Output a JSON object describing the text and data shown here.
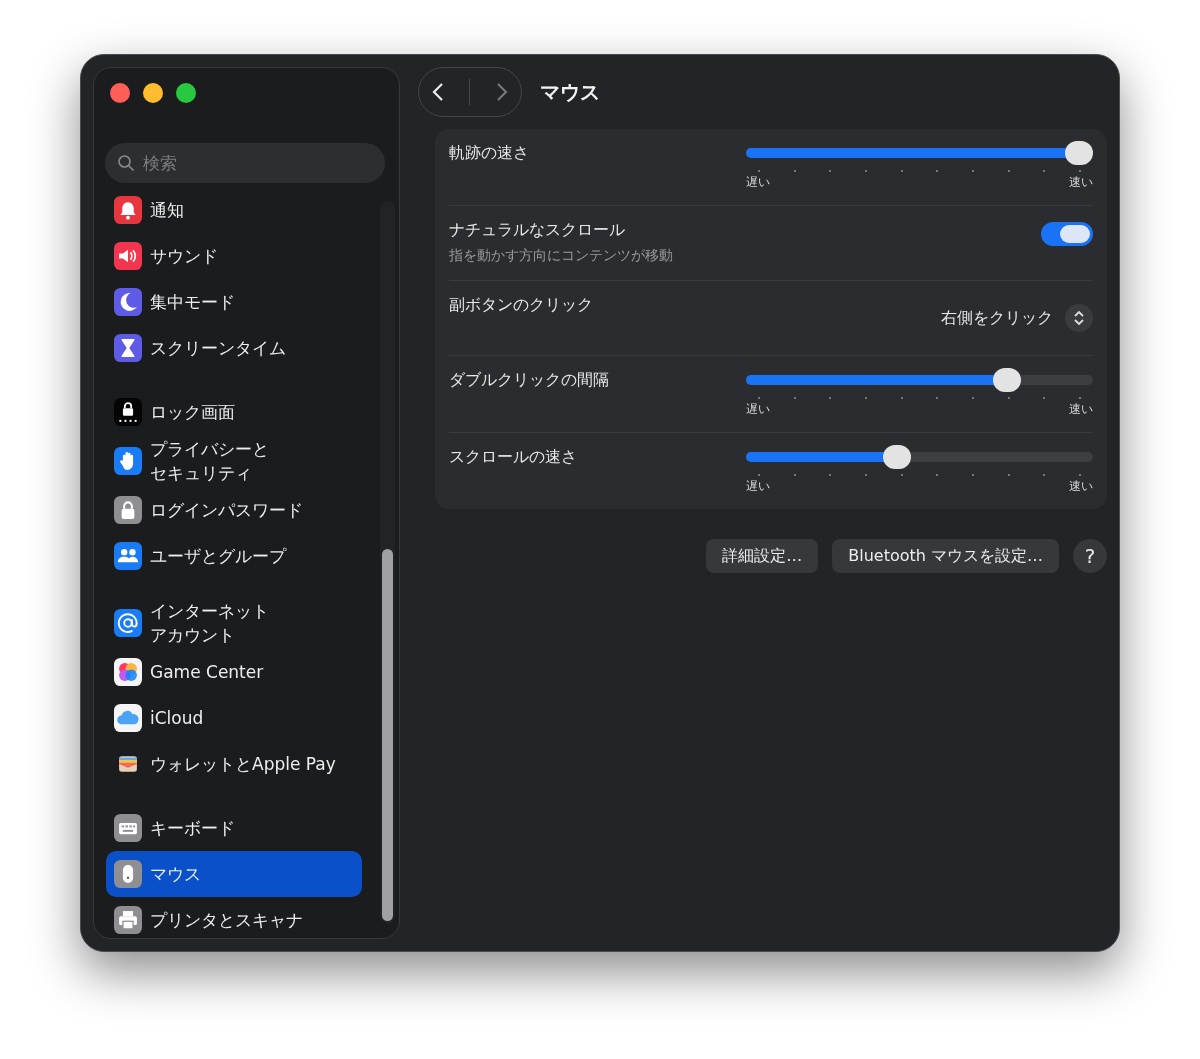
{
  "sidebar": {
    "search": {
      "placeholder": "検索"
    },
    "groups": [
      {
        "items": [
          {
            "label": "通知",
            "selected": false
          },
          {
            "label": "サウンド",
            "selected": false
          },
          {
            "label": "集中モード",
            "selected": false
          },
          {
            "label": "スクリーンタイム",
            "selected": false
          }
        ]
      },
      {
        "items": [
          {
            "label": "ロック画面",
            "selected": false
          },
          {
            "label": "プライバシーとセキュリティ",
            "selected": false,
            "wrapped": true
          },
          {
            "label": "ログインパスワード",
            "selected": false
          },
          {
            "label": "ユーザとグループ",
            "selected": false
          }
        ]
      },
      {
        "items": [
          {
            "label": "インターネットアカウント",
            "selected": false,
            "wrapped": true
          },
          {
            "label": "Game Center",
            "selected": false
          },
          {
            "label": "iCloud",
            "selected": false
          },
          {
            "label": "ウォレットとApple Pay",
            "selected": false
          }
        ]
      },
      {
        "items": [
          {
            "label": "キーボード",
            "selected": false
          },
          {
            "label": "マウス",
            "selected": true
          },
          {
            "label": "プリンタとスキャナ",
            "selected": false
          }
        ]
      }
    ]
  },
  "header": {
    "title": "マウス"
  },
  "settings": [
    {
      "kind": "slider",
      "label": "軌跡の速さ",
      "level": 1.0,
      "min_label": "遅い",
      "max_label": "速い"
    },
    {
      "kind": "toggle",
      "label": "ナチュラルなスクロール",
      "description": "指を動かす方向にコンテンツが移動",
      "on": true
    },
    {
      "kind": "popup",
      "label": "副ボタンのクリック",
      "value": "右側をクリック"
    },
    {
      "kind": "slider",
      "label": "ダブルクリックの間隔",
      "level": 0.775,
      "min_label": "遅い",
      "max_label": "速い"
    },
    {
      "kind": "slider",
      "label": "スクロールの速さ",
      "level": 0.43,
      "min_label": "遅い",
      "max_label": "速い"
    }
  ],
  "buttons": [
    {
      "label": "詳細設定…"
    },
    {
      "label": "Bluetooth マウスを設定…"
    }
  ],
  "help_button": "?"
}
